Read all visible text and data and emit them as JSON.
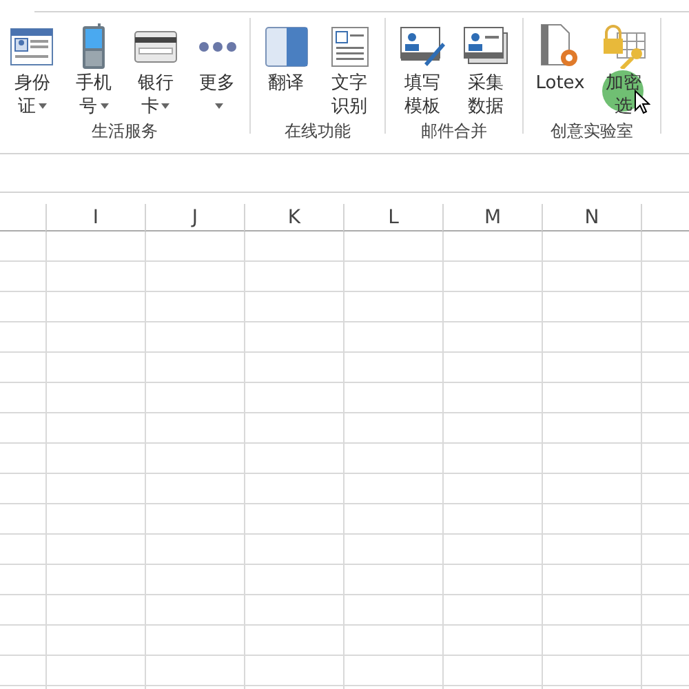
{
  "ribbon": {
    "groups": [
      {
        "title": "生活服务",
        "buttons": [
          {
            "label": "身份证",
            "dropdown": true
          },
          {
            "label": "手机号",
            "dropdown": true
          },
          {
            "label": "银行卡",
            "dropdown": true
          },
          {
            "label": "更多",
            "dropdown": true
          }
        ]
      },
      {
        "title": "在线功能",
        "buttons": [
          {
            "label": "翻译",
            "dropdown": false
          },
          {
            "label": "文字识别",
            "dropdown": false
          }
        ]
      },
      {
        "title": "邮件合并",
        "buttons": [
          {
            "label": "填写模板",
            "dropdown": false
          },
          {
            "label": "采集数据",
            "dropdown": false
          }
        ]
      },
      {
        "title": "创意实验室",
        "buttons": [
          {
            "label": "Lotex",
            "dropdown": false
          },
          {
            "label": "加密选",
            "dropdown": false,
            "highlighted": true
          }
        ]
      }
    ]
  },
  "sheet": {
    "columns": [
      "I",
      "J",
      "K",
      "L",
      "M",
      "N"
    ]
  }
}
